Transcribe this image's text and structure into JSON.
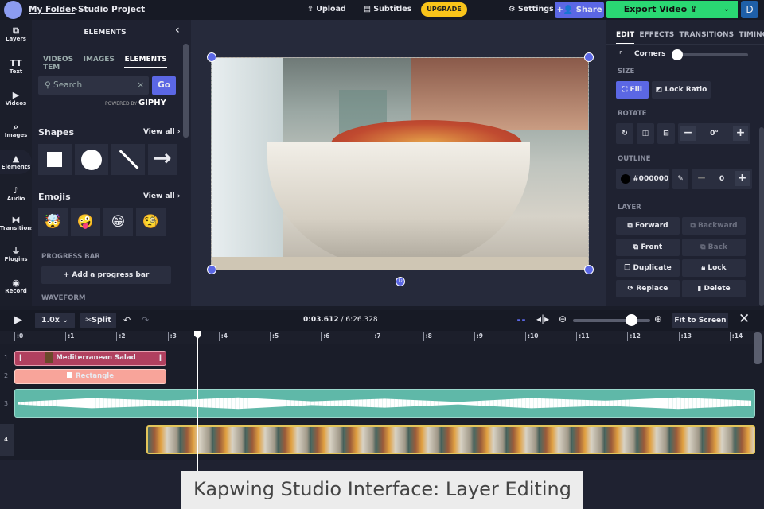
{
  "header": {
    "folder": "My Folder",
    "separator": ">",
    "project": "Studio Project",
    "upload": "Upload",
    "subtitles": "Subtitles",
    "upgrade": "UPGRADE",
    "settings": "Settings",
    "share": "Share",
    "export": "Export Video",
    "user_initial": "D"
  },
  "rail": [
    {
      "label": "Layers",
      "icon": "⧉"
    },
    {
      "label": "Text",
      "icon": "TT"
    },
    {
      "label": "Videos",
      "icon": "▶"
    },
    {
      "label": "Images",
      "icon": "⌕"
    },
    {
      "label": "Elements",
      "icon": "▲"
    },
    {
      "label": "Audio",
      "icon": "♪"
    },
    {
      "label": "Transitions",
      "icon": "⋈"
    },
    {
      "label": "Plugins",
      "icon": "⏚"
    },
    {
      "label": "Record",
      "icon": "◉"
    }
  ],
  "panel": {
    "title": "ELEMENTS",
    "tabs": [
      "VIDEOS",
      "IMAGES",
      "ELEMENTS",
      "TEM"
    ],
    "search_placeholder": "Search",
    "go": "Go",
    "powered": "POWERED BY",
    "giphy": "GIPHY",
    "shapes": "Shapes",
    "emojis": "Emojis",
    "view_all": "View all ›",
    "emoji_list": [
      "🤯",
      "🤪",
      "😁",
      "🧐"
    ],
    "progress_bar": "PROGRESS BAR",
    "add_progress": "+  Add a progress bar",
    "waveform": "WAVEFORM"
  },
  "right": {
    "tabs": [
      "EDIT",
      "EFFECTS",
      "TRANSITIONS",
      "TIMING"
    ],
    "corners": "Corners",
    "corners_value": 0,
    "size": "SIZE",
    "fill": "Fill",
    "lock_ratio": "Lock Ratio",
    "rotate": "ROTATE",
    "rotate_value": "0°",
    "outline": "OUTLINE",
    "outline_color": "#000000",
    "outline_value": "0",
    "layer": "LAYER",
    "forward": "Forward",
    "backward": "Backward",
    "front": "Front",
    "back": "Back",
    "duplicate": "Duplicate",
    "lock": "Lock",
    "replace": "Replace",
    "delete": "Delete"
  },
  "timeline": {
    "speed": "1.0x",
    "split": "Split",
    "current": "0:03.612",
    "total": "/ 6:26.328",
    "fit": "Fit to Screen",
    "zoom_level": 0.75,
    "ticks": [
      ":0",
      ":1",
      ":2",
      ":3",
      ":4",
      ":5",
      ":6",
      ":7",
      ":8",
      ":9",
      ":10",
      ":11",
      ":12",
      ":13",
      ":14"
    ],
    "tracks": [
      {
        "num": "1",
        "label": "Mediterranean Salad",
        "color": "#b0405f"
      },
      {
        "num": "2",
        "label": "Rectangle",
        "color": "#f8a49a"
      },
      {
        "num": "3",
        "color": "#5fb8a8"
      },
      {
        "num": "4",
        "color": "#e3c55a"
      }
    ]
  },
  "caption": "Kapwing Studio Interface: Layer Editing"
}
